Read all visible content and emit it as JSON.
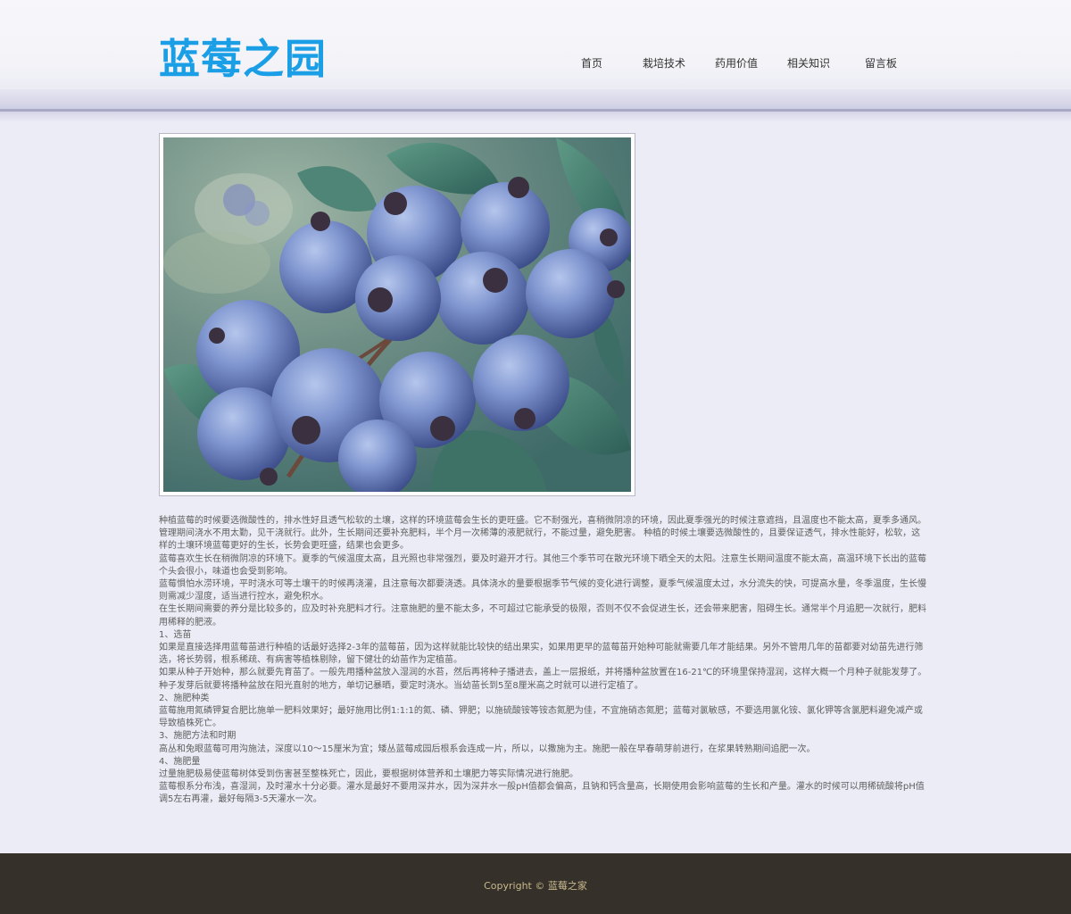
{
  "header": {
    "logo_text": "蓝莓之园",
    "nav": [
      "首页",
      "栽培技术",
      "药用价值",
      "相关知识",
      "留言板"
    ]
  },
  "main": {
    "image_alt": "蓝莓果实特写",
    "paragraphs": [
      "种植蓝莓的时候要选微酸性的，排水性好且透气松软的土壤，这样的环境蓝莓会生长的更旺盛。它不耐强光，喜稍微阴凉的环境，因此夏季强光的时候注意遮挡，且温度也不能太高，夏季多通风。管理期间浇水不用太勤，见干浇就行。此外，生长期间还要补充肥料，半个月一次稀薄的液肥就行，不能过量，避免肥害。 种植的时候土壤要选微酸性的，且要保证透气，排水性能好，松软，这样的土壤环境蓝莓更好的生长，长势会更旺盛，结果也会更多。",
      "蓝莓喜欢生长在稍微阴凉的环境下。夏季的气候温度太高，且光照也非常强烈，要及时避开才行。其他三个季节可在散光环境下晒全天的太阳。注意生长期间温度不能太高，高温环境下长出的蓝莓个头会很小，味道也会受到影响。",
      "蓝莓惧怕水涝环境，平时浇水可等土壤干的时候再浇灌，且注意每次都要浇透。具体浇水的量要根据季节气候的变化进行调整，夏季气候温度太过，水分流失的快，可提高水量，冬季温度，生长慢则需减少湿度，适当进行控水，避免积水。",
      "在生长期间需要的养分是比较多的，应及时补充肥料才行。注意施肥的量不能太多，不可超过它能承受的极限，否则不仅不会促进生长，还会带来肥害，阻碍生长。通常半个月追肥一次就行，肥料用稀释的肥液。",
      "1、选苗",
      "如果是直接选择用蓝莓苗进行种植的话最好选择2-3年的蓝莓苗，因为这样就能比较快的结出果实，如果用更早的蓝莓苗开始种可能就需要几年才能结果。另外不管用几年的苗都要对幼苗先进行筛选，将长势弱，根系稀疏、有病害等植株剔除，留下健壮的幼苗作为定植苗。",
      "如果从种子开始种，那么就要先育苗了。一般先用播种盆放入湿润的水苔，然后再将种子播进去，盖上一层报纸，并将播种盆放置在16-21℃的环境里保持湿润，这样大概一个月种子就能发芽了。种子发芽后就要将播种盆放在阳光直射的地方，单切记暴晒，要定时浇水。当幼苗长到5至8厘米高之时就可以进行定植了。",
      "2、施肥种类",
      "蓝莓施用氮磷钾复合肥比施单一肥料效果好；最好施用比例1:1:1的氮、磷、钾肥；以施硫酸铵等铵态氮肥为佳，不宜施硝态氮肥；蓝莓对氯敏感，不要选用氯化铵、氯化钾等含氯肥料避免减产或导致植株死亡。",
      "3、施肥方法和时期",
      "高丛和兔眼蓝莓可用沟施法，深度以10～15厘米为宜；矮丛蓝莓成园后根系会连成一片，所以，以撒施为主。施肥一般在早春萌芽前进行，在浆果转熟期间追肥一次。",
      "4、施肥量",
      "过量施肥极易使蓝莓树体受到伤害甚至整株死亡，因此，要根据树体营养和土壤肥力等实际情况进行施肥。",
      "蓝莓根系分布浅，喜湿润，及时灌水十分必要。灌水是最好不要用深井水，因为深井水一般pH值都会偏高，且钠和钙含量高，长期使用会影响蓝莓的生长和产量。灌水的时候可以用稀硫酸将pH值调5左右再灌，最好每隔3-5天灌水一次。"
    ]
  },
  "footer": {
    "copyright": "Copyright © 蓝莓之家"
  }
}
